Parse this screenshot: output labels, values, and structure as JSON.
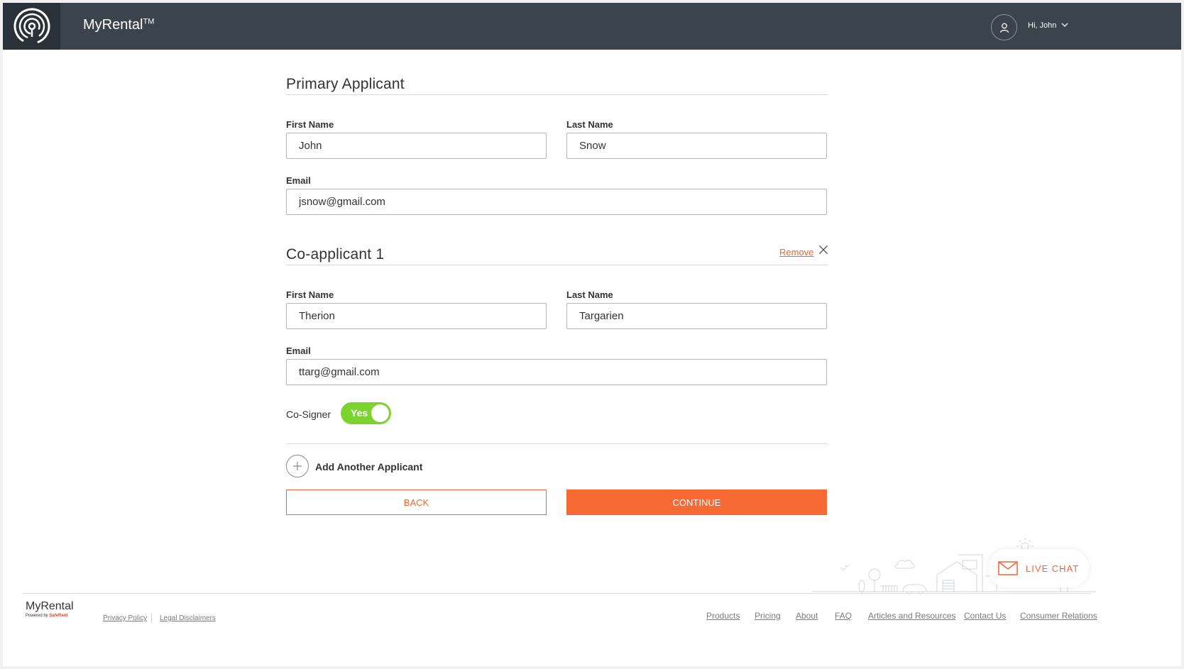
{
  "header": {
    "brand": "MyRental",
    "brand_tm": "TM",
    "greeting": "Hi, John"
  },
  "primary": {
    "title": "Primary Applicant",
    "first_name_label": "First Name",
    "first_name": "John",
    "last_name_label": "Last Name",
    "last_name": "Snow",
    "email_label": "Email",
    "email": "jsnow@gmail.com"
  },
  "coapplicant": {
    "title": "Co-applicant 1",
    "remove_label": "Remove",
    "first_name_label": "First Name",
    "first_name": "Therion",
    "last_name_label": "Last Name",
    "last_name": "Targarien",
    "email_label": "Email",
    "email": "ttarg@gmail.com",
    "cosigner_label": "Co-Signer",
    "cosigner_value": "Yes"
  },
  "actions": {
    "add_applicant": "Add Another Applicant",
    "back": "BACK",
    "continue": "CONTINUE"
  },
  "live_chat": {
    "label": "LIVE CHAT"
  },
  "footer": {
    "logo": "MyRental",
    "powered_by": "Powered by",
    "powered_brand": "SafeRent",
    "privacy": "Privacy Policy",
    "legal": "Legal Disclaimers",
    "links": [
      "Products",
      "Pricing",
      "About",
      "FAQ",
      "Articles and Resources",
      "Contact Us",
      "Consumer Relations"
    ]
  },
  "colors": {
    "header_bg": "#3b444c",
    "accent": "#f86a33",
    "toggle_on": "#7bd32e"
  },
  "icons": {
    "logo": "fingerprint-logo-icon",
    "user": "user-icon",
    "chevron": "chevron-down-icon",
    "close": "close-icon",
    "add": "plus-circle-icon",
    "chat": "envelope-icon"
  }
}
